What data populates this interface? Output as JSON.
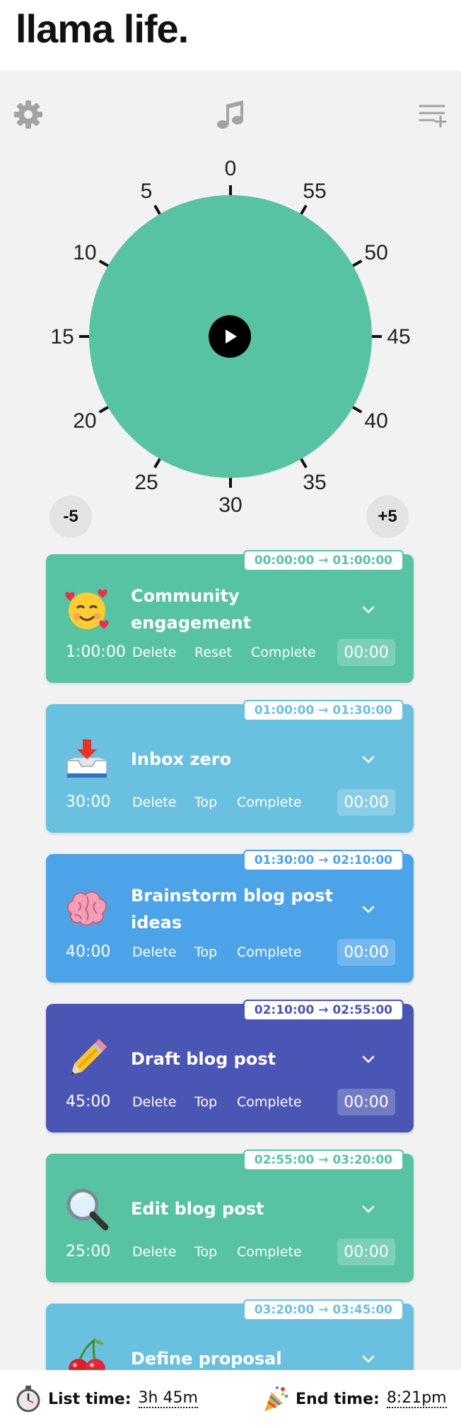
{
  "app": {
    "logo": "llama life."
  },
  "toolbar": {
    "settings_icon": "gear-icon",
    "music_icon": "music-note-icon",
    "add_list_icon": "add-list-icon"
  },
  "dial": {
    "color": "#57c3a2",
    "numbers": [
      "0",
      "5",
      "10",
      "15",
      "20",
      "25",
      "30",
      "35",
      "40",
      "45",
      "50",
      "55"
    ],
    "play_icon": "play-icon",
    "minus_label": "-5",
    "plus_label": "+5"
  },
  "tasks": [
    {
      "emoji": "smiling-face-with-hearts",
      "title": "Community engagement",
      "duration": "1:00:00",
      "actions": [
        "Delete",
        "Reset",
        "Complete"
      ],
      "timer": "00:00",
      "start": "00:00:00",
      "end": "01:00:00",
      "color": "#57c3a2"
    },
    {
      "emoji": "inbox-tray",
      "title": "Inbox zero",
      "duration": "30:00",
      "actions": [
        "Delete",
        "Top",
        "Complete"
      ],
      "timer": "00:00",
      "start": "01:00:00",
      "end": "01:30:00",
      "color": "#69c1df"
    },
    {
      "emoji": "brain",
      "title": "Brainstorm blog post ideas",
      "duration": "40:00",
      "actions": [
        "Delete",
        "Top",
        "Complete"
      ],
      "timer": "00:00",
      "start": "01:30:00",
      "end": "02:10:00",
      "color": "#4da3e8"
    },
    {
      "emoji": "pencil",
      "title": "Draft blog post",
      "duration": "45:00",
      "actions": [
        "Delete",
        "Top",
        "Complete"
      ],
      "timer": "00:00",
      "start": "02:10:00",
      "end": "02:55:00",
      "color": "#4b56b4"
    },
    {
      "emoji": "magnifying-glass",
      "title": "Edit blog post",
      "duration": "25:00",
      "actions": [
        "Delete",
        "Top",
        "Complete"
      ],
      "timer": "00:00",
      "start": "02:55:00",
      "end": "03:20:00",
      "color": "#57c3a2"
    },
    {
      "emoji": "cherries",
      "title": "Define proposal",
      "duration": "",
      "actions": [],
      "timer": "",
      "start": "03:20:00",
      "end": "03:45:00",
      "color": "#69c1df"
    }
  ],
  "footer": {
    "list_time_icon": "stopwatch-icon",
    "list_time_label": "List time:",
    "list_time_value": "3h 45m",
    "end_time_icon": "party-popper-icon",
    "end_time_label": "End time:",
    "end_time_value": "8:21pm"
  }
}
